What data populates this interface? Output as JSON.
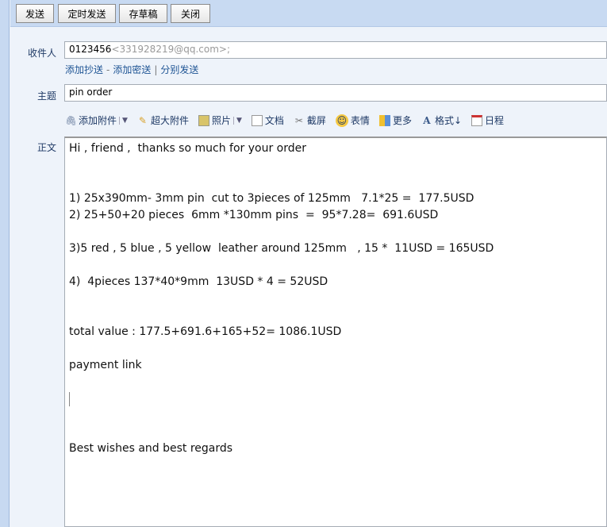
{
  "toolbar": {
    "send": "发送",
    "scheduled_send": "定时发送",
    "save_draft": "存草稿",
    "close": "关闭"
  },
  "recipient": {
    "label": "收件人",
    "name": "0123456",
    "email": "<331928219@qq.com>;"
  },
  "recipient_links": {
    "cc": "添加抄送",
    "separator1": "-",
    "bcc": "添加密送",
    "separator2": "|",
    "separate_send": "分别发送"
  },
  "subject": {
    "label": "主题",
    "value": "pin order"
  },
  "editor_tools": [
    {
      "icon": "paperclip-icon",
      "label": "添加附件",
      "dropdown": true
    },
    {
      "icon": "big-attachment-icon",
      "label": "超大附件"
    },
    {
      "icon": "photo-icon",
      "label": "照片",
      "dropdown": true
    },
    {
      "icon": "document-icon",
      "label": "文档"
    },
    {
      "icon": "screenshot-icon",
      "label": "截屏"
    },
    {
      "icon": "smiley-icon",
      "label": "表情"
    },
    {
      "icon": "more-icon",
      "label": "更多"
    },
    {
      "icon": "format-icon",
      "label": "格式↓"
    },
    {
      "icon": "calendar-icon",
      "label": "日程"
    }
  ],
  "body": {
    "label": "正文",
    "lines": [
      "Hi , friend ,  thanks so much for your order",
      "",
      "",
      "1) 25x390mm- 3mm pin  cut to 3pieces of 125mm   7.1*25 =  177.5USD",
      "2) 25+50+20 pieces  6mm *130mm pins  =  95*7.28=  691.6USD",
      "",
      "3)5 red , 5 blue , 5 yellow  leather around 125mm   , 15 *  11USD = 165USD",
      "",
      "4)  4pieces 137*40*9mm  13USD * 4 = 52USD",
      "",
      "",
      "total value : 177.5+691.6+165+52= 1086.1USD",
      "",
      "payment link",
      "",
      "",
      "",
      "",
      "Best wishes and best regards"
    ]
  }
}
